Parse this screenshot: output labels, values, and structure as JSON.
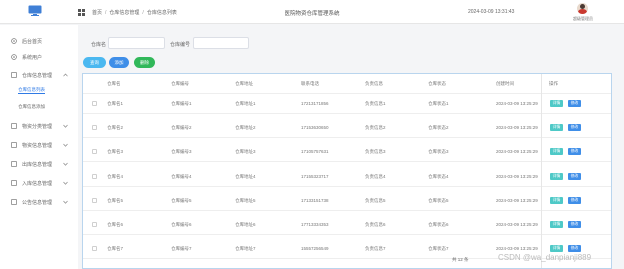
{
  "header": {
    "breadcrumb": [
      "首页",
      "仓库信息管理",
      "仓库信息列表"
    ],
    "system_title": "医院物资仓库管理系统",
    "datetime": "2024-03-09 13:31:43",
    "user_name": "超级管理员"
  },
  "sidebar": {
    "items": [
      {
        "label": "后台首页",
        "icon": "home-icon"
      },
      {
        "label": "系统用户",
        "icon": "user-icon"
      },
      {
        "label": "仓库信息管理",
        "icon": "warehouse-icon",
        "expanded": true
      },
      {
        "label": "物资分类管理",
        "icon": "category-icon"
      },
      {
        "label": "物资信息管理",
        "icon": "box-icon"
      },
      {
        "label": "出库信息管理",
        "icon": "export-icon"
      },
      {
        "label": "入库信息管理",
        "icon": "import-icon"
      },
      {
        "label": "公告信息管理",
        "icon": "notice-icon"
      }
    ],
    "sub_items": [
      {
        "label": "仓库信息列表",
        "active": true
      },
      {
        "label": "仓库信息添加",
        "active": false
      }
    ]
  },
  "search": {
    "name_label": "仓库名",
    "name_placeholder": "",
    "code_label": "仓库编号",
    "code_placeholder": "",
    "query_label": "查询",
    "add_label": "添加",
    "delete_label": "删除"
  },
  "table": {
    "columns": [
      "仓库名",
      "仓库编号",
      "仓库地址",
      "联系电话",
      "负责信息",
      "仓库状态",
      "创建时间",
      "操作"
    ],
    "rows": [
      [
        "仓库名1",
        "仓库编号1",
        "仓库地址1",
        "17213171856",
        "负责信息1",
        "仓库状态1",
        "2024-03-09 13:25:29"
      ],
      [
        "仓库名2",
        "仓库编号2",
        "仓库地址2",
        "17153630650",
        "负责信息2",
        "仓库状态2",
        "2024-03-09 13:25:29"
      ],
      [
        "仓库名3",
        "仓库编号3",
        "仓库地址3",
        "17105757631",
        "负责信息3",
        "仓库状态3",
        "2024-03-09 13:25:29"
      ],
      [
        "仓库名4",
        "仓库编号4",
        "仓库地址4",
        "17155323717",
        "负责信息4",
        "仓库状态4",
        "2024-03-09 13:25:29"
      ],
      [
        "仓库名5",
        "仓库编号5",
        "仓库地址5",
        "17133151738",
        "负责信息5",
        "仓库状态5",
        "2024-03-09 13:25:29"
      ],
      [
        "仓库名6",
        "仓库编号6",
        "仓库地址6",
        "17713334353",
        "负责信息6",
        "仓库状态6",
        "2024-03-09 13:25:29"
      ],
      [
        "仓库名7",
        "仓库编号7",
        "仓库地址7",
        "15557256549",
        "负责信息7",
        "仓库状态7",
        "2024-03-09 13:25:29"
      ]
    ],
    "detail_label": "详情",
    "edit_label": "修改"
  },
  "footer": {
    "total": "共 12 条",
    "watermark": "CSDN @wa_danpianji889"
  },
  "colors": {
    "accent": "#3f8ee8",
    "query": "#4bb8f0",
    "delete": "#31b85a",
    "detail": "#4ec9c7"
  }
}
